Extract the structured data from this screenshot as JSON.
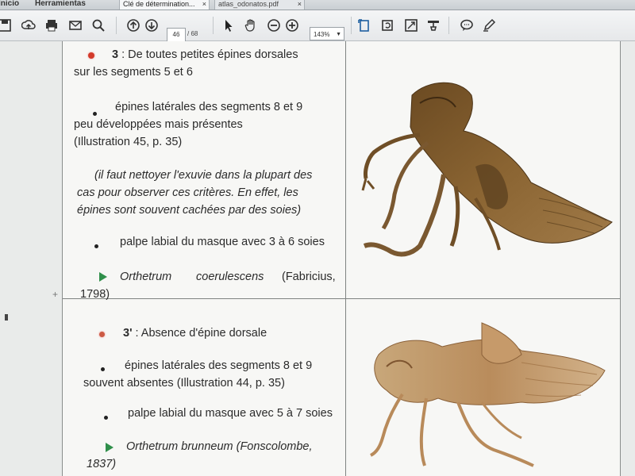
{
  "menu": {
    "inicio": "Inicio",
    "herramientas": "Herramientas"
  },
  "tabs": [
    {
      "label": "Clé de détermination...",
      "close": "×"
    },
    {
      "label": "atlas_odonatos.pdf",
      "close": "×"
    }
  ],
  "toolbar": {
    "icons": [
      "save-icon",
      "cloud-upload-icon",
      "print-icon",
      "mail-icon",
      "search-icon",
      "page-up-icon",
      "page-down-icon",
      "select-arrow-icon",
      "hand-icon",
      "zoom-out-icon",
      "zoom-in-icon",
      "fit-page-icon",
      "rotate-icon",
      "fit-width-icon",
      "stamp-icon",
      "comment-icon",
      "pen-icon"
    ],
    "page_current": "46",
    "page_total": "/ 68",
    "zoom": "143%"
  },
  "doc": {
    "s3_title_num": "3",
    "s3_title_rest": " : De toutes petites épines dorsales",
    "s3_title_line2": "sur les segments 5 et 6",
    "s3_b1_l1": "épines latérales des segments 8 et 9",
    "s3_b1_l2": "peu développées mais présentes",
    "s3_b1_l3": "(Illustration 45, p. 35)",
    "s3_note_l1": "(il faut nettoyer l'exuvie dans la plupart des",
    "s3_note_l2": "cas pour observer ces critères. En effet, les",
    "s3_note_l3": "épines sont souvent cachées par des soies)",
    "s3_b2": "palpe labial du masque avec 3 à 6 soies",
    "s3_species": "Orthetrum",
    "s3_species2": "coerulescens",
    "s3_author": "(Fabricius,",
    "s3_year": "1798)",
    "s3p_title_num": "3'",
    "s3p_title_rest": " : Absence d'épine dorsale",
    "s3p_b1_l1": "épines latérales des segments 8 et 9",
    "s3p_b1_l2": "souvent absentes (Illustration 44, p. 35)",
    "s3p_b2": "palpe labial du masque avec 5 à 7 soies",
    "s3p_species": "Orthetrum brunneum (Fonscolombe,",
    "s3p_year": "1837)"
  },
  "colors": {
    "bullet_red": "#d33a2a",
    "arrow_green": "#2f8f4a"
  }
}
